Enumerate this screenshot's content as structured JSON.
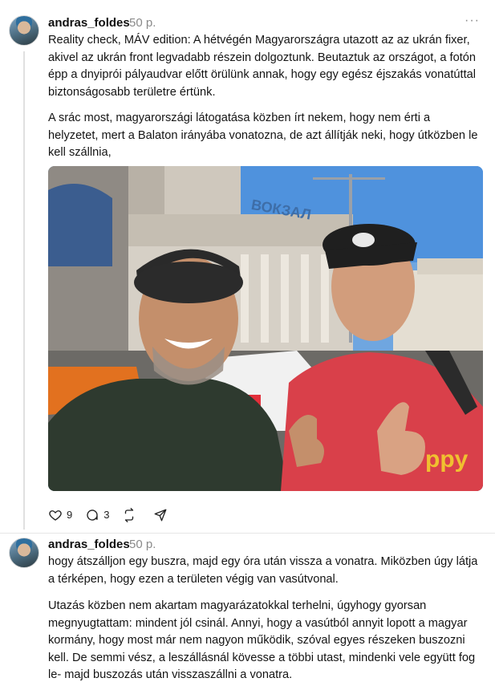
{
  "post1": {
    "author": "andras_foldes",
    "time": "50 p.",
    "more_label": "···",
    "paragraphs": [
      "Reality check, MÁV edition: A hétvégén Magyarországra utazott az az ukrán fixer, akivel az ukrán front legvadabb részein dolgoztunk. Beutaztuk az országot, a fotón épp a dnyiprói pályaudvar előtt örülünk annak, hogy egy egész éjszakás vonatúttal biztonságosabb területre értünk.",
      "A srác most, magyarországi látogatása közben írt nekem, hogy nem érti a helyzetet, mert a Balaton irányába vonatozna, de azt állítják neki, hogy útközben le kell szállnia,"
    ],
    "photo": {
      "building_sign": "ВОКЗАЛ",
      "shirt_text": "ppy"
    },
    "actions": {
      "likes": "9",
      "replies": "3"
    }
  },
  "post2": {
    "author": "andras_foldes",
    "time": "50 p.",
    "paragraphs": [
      "hogy átszálljon egy buszra, majd egy óra után vissza a vonatra. Miközben úgy látja a térképen, hogy ezen a területen végig van vasútvonal.",
      "Utazás közben nem akartam magyarázatokkal terhelni, úgyhogy gyorsan megnyugtattam: mindent jól csinál. Annyi, hogy a vasútból annyit lopott a magyar kormány, hogy most már nem nagyon működik, szóval egyes részeken buszozni kell. De semmi vész, a leszállásnál kövesse a többi utast, mindenki vele együtt fog le- majd buszozás után visszaszállni a vonatra."
    ]
  },
  "colors": {
    "text": "#141414",
    "muted": "#8a8a8a",
    "thread_line": "#e0e0e0"
  }
}
